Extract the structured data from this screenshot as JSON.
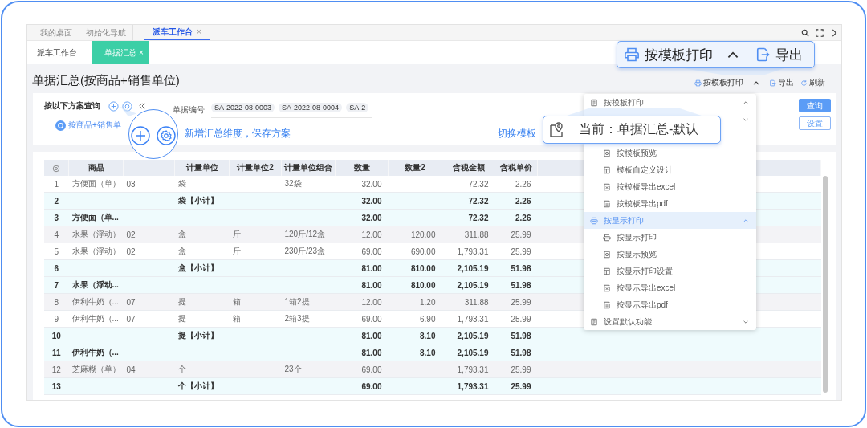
{
  "top_tabs": [
    {
      "label": "我的桌面",
      "selected": false
    },
    {
      "label": "初始化导航",
      "selected": false
    },
    {
      "label": "派车工作台",
      "selected": true,
      "close": "×"
    }
  ],
  "sub_tabs": [
    {
      "label": "派车工作台",
      "selected": false
    },
    {
      "label": "单据汇总",
      "selected": true,
      "close": "×"
    }
  ],
  "page_title": "单据汇总(按商品+销售单位)",
  "toolbar": [
    {
      "kind": "print",
      "label": "按模板打印"
    },
    {
      "kind": "caret"
    },
    {
      "kind": "export",
      "label": "导出"
    },
    {
      "kind": "refresh",
      "label": "刷新"
    }
  ],
  "query_panel": {
    "title": "按以下方案查询",
    "scheme": "按商品+销售单"
  },
  "filter": {
    "label": "单据编号",
    "tags": [
      "SA-2022-08-0003",
      "SA-2022-08-0004",
      "SA-2"
    ]
  },
  "buttons": [
    {
      "kind": "primary",
      "label": "查询"
    },
    {
      "kind": "secondary",
      "label": "设置"
    }
  ],
  "table": {
    "columns": [
      {
        "kind": "index"
      },
      {
        "kind": "text",
        "label": "商品"
      },
      {
        "kind": "text"
      },
      {
        "kind": "text",
        "label": "计量单位"
      },
      {
        "kind": "text",
        "label": "计量单位2"
      },
      {
        "kind": "text",
        "label": "计量单位组合"
      },
      {
        "kind": "number",
        "label": "数量"
      },
      {
        "kind": "number",
        "label": "数量2"
      },
      {
        "kind": "number",
        "label": "含税金额"
      },
      {
        "kind": "number",
        "label": "含税单价"
      }
    ],
    "rows": [
      {
        "kind": "detail",
        "cells": [
          "1",
          "方便面（单）",
          "03",
          "袋",
          null,
          "32袋",
          "32.00",
          null,
          "72.32",
          "2.26"
        ]
      },
      {
        "kind": "subtotal",
        "cells": [
          "2",
          null,
          null,
          "袋【小计】",
          null,
          null,
          "32.00",
          null,
          "72.32",
          "2.26"
        ]
      },
      {
        "kind": "subtotal",
        "cells": [
          "3",
          "方便面（单...",
          null,
          null,
          null,
          null,
          "32.00",
          null,
          "72.32",
          "2.26"
        ]
      },
      {
        "kind": "detail",
        "cells": [
          "4",
          "水果（浮动）",
          "02",
          "盒",
          "斤",
          "120斤/12盒",
          "12.00",
          "120.00",
          "311.88",
          "25.99"
        ]
      },
      {
        "kind": "detail",
        "cells": [
          "5",
          "水果（浮动）",
          "02",
          "盒",
          "斤",
          "230斤/23盒",
          "69.00",
          "690.00",
          "1,793.31",
          "25.99"
        ]
      },
      {
        "kind": "subtotal",
        "cells": [
          "6",
          null,
          null,
          "盒【小计】",
          null,
          null,
          "81.00",
          "810.00",
          "2,105.19",
          "51.98"
        ]
      },
      {
        "kind": "subtotal",
        "cells": [
          "7",
          "水果（浮动...",
          null,
          null,
          null,
          null,
          "81.00",
          "810.00",
          "2,105.19",
          "51.98"
        ]
      },
      {
        "kind": "detail",
        "cells": [
          "8",
          "伊利牛奶（...",
          "07",
          "提",
          "箱",
          "1箱2提",
          "12.00",
          "1.20",
          "311.88",
          "25.99"
        ]
      },
      {
        "kind": "detail",
        "cells": [
          "9",
          "伊利牛奶（...",
          "07",
          "提",
          "箱",
          "2箱3提",
          "69.00",
          "6.90",
          "1,793.31",
          "25.99"
        ]
      },
      {
        "kind": "subtotal",
        "cells": [
          "10",
          null,
          null,
          "提【小计】",
          null,
          null,
          "81.00",
          "8.10",
          "2,105.19",
          "51.98"
        ]
      },
      {
        "kind": "subtotal",
        "cells": [
          "11",
          "伊利牛奶（...",
          null,
          null,
          null,
          null,
          "81.00",
          "8.10",
          "2,105.19",
          "51.98"
        ]
      },
      {
        "kind": "detail",
        "cells": [
          "12",
          "芝麻糊（单）",
          "04",
          "个",
          null,
          "23个",
          "69.00",
          null,
          "1,793.31",
          "25.99"
        ]
      },
      {
        "kind": "subtotal",
        "cells": [
          "13",
          null,
          null,
          "个【小计】",
          null,
          null,
          "69.00",
          null,
          "1,793.31",
          "25.99"
        ]
      }
    ]
  },
  "print_menu": [
    {
      "kind": "group",
      "label": "按模板打印",
      "expanded": true,
      "selected": false
    },
    {
      "kind": "select"
    },
    {
      "kind": "covered"
    },
    {
      "kind": "item",
      "label": "按模板预览"
    },
    {
      "kind": "item",
      "label": "模板自定义设计"
    },
    {
      "kind": "item",
      "label": "按模板导出excel"
    },
    {
      "kind": "item",
      "label": "按模板导出pdf"
    },
    {
      "kind": "group",
      "label": "按显示打印",
      "expanded": true,
      "selected": true
    },
    {
      "kind": "item",
      "label": "按显示打印"
    },
    {
      "kind": "item",
      "label": "按显示预览"
    },
    {
      "kind": "item",
      "label": "按显示打印设置"
    },
    {
      "kind": "item",
      "label": "按显示导出excel"
    },
    {
      "kind": "item",
      "label": "按显示导出pdf"
    },
    {
      "kind": "group",
      "label": "设置默认功能",
      "expanded": false,
      "selected": false
    }
  ],
  "callouts": {
    "scheme_caption": "新增汇总维度，保存方案",
    "print_label": "按模板打印",
    "export_label": "导出",
    "switch_link": "切换模板",
    "current_template": "当前：单据汇总-默认"
  }
}
